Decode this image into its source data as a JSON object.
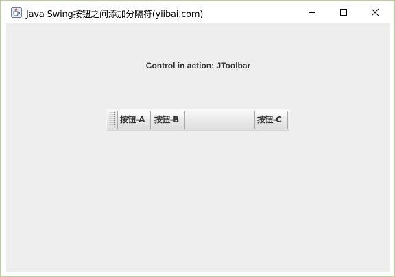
{
  "window": {
    "title": "Java Swing按钮之间添加分隔符(yiibai.com)",
    "app_icon": "java-coffee-cup-icon",
    "controls": {
      "minimize_icon": "minimize-icon",
      "maximize_icon": "maximize-icon",
      "close_icon": "close-icon"
    }
  },
  "content": {
    "heading": "Control in action: JToolbar"
  },
  "toolbar": {
    "grip_icon": "toolbar-grip-icon",
    "buttons": [
      {
        "label": "按钮-A"
      },
      {
        "label": "按钮-B"
      },
      {
        "label": "按钮-C"
      }
    ],
    "separator_after_index": 1
  },
  "colors": {
    "window_border": "#b9d28c",
    "content_background": "#eeeeee",
    "text": "#333333"
  }
}
